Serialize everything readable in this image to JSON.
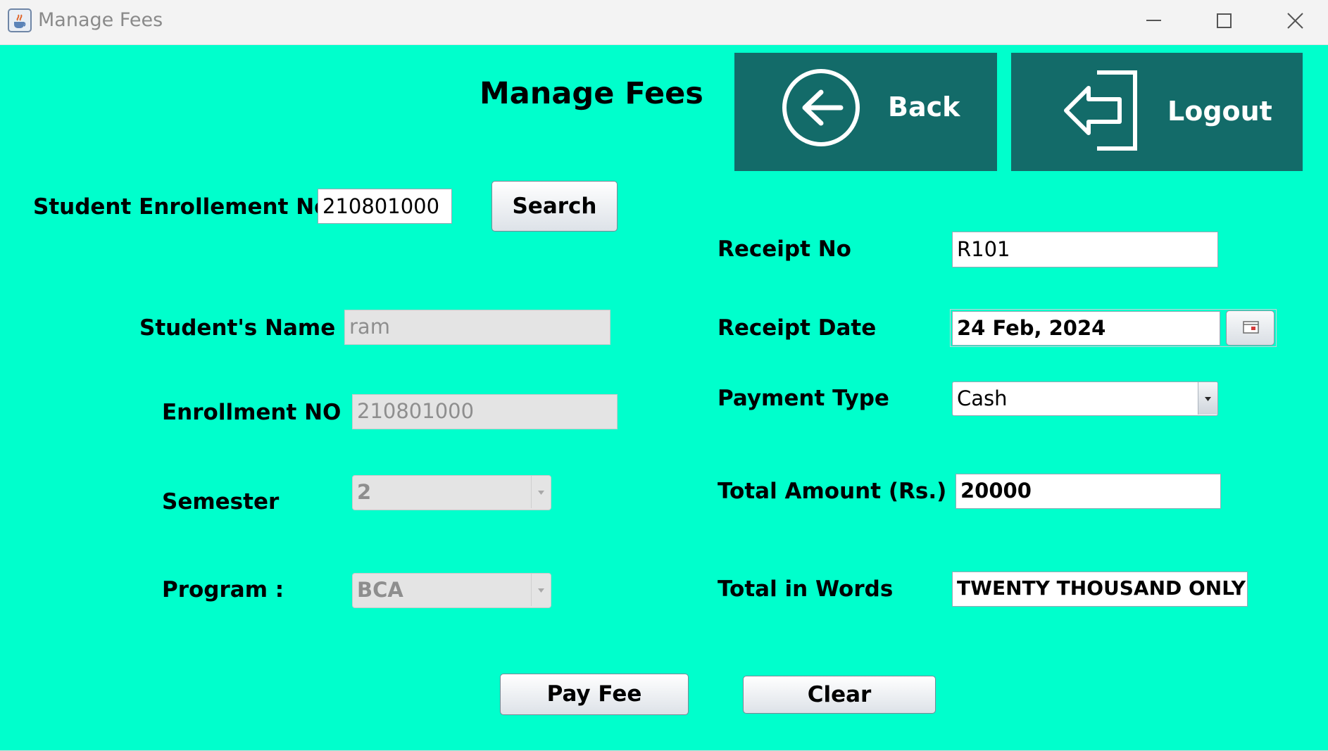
{
  "window": {
    "title": "Manage Fees",
    "app_icon": "java-cup-icon",
    "controls": [
      "minimize-icon",
      "maximize-icon",
      "close-icon"
    ]
  },
  "header": {
    "title": "Manage Fees",
    "back_label": "Back",
    "back_icon": "arrow-left-circle-icon",
    "logout_label": "Logout",
    "logout_icon": "logout-icon"
  },
  "search": {
    "label": "Student Enrollement No:",
    "value": "210801000",
    "button_label": "Search"
  },
  "student": {
    "name_label": "Student's Name",
    "name_value": "ram",
    "enrollment_label": "Enrollment NO",
    "enrollment_value": "210801000",
    "semester_label": "Semester",
    "semester_value": "2",
    "program_label": "Program :",
    "program_value": "BCA"
  },
  "receipt": {
    "no_label": "Receipt No",
    "no_value": "R101",
    "date_label": "Receipt Date",
    "date_value": "24 Feb, 2024",
    "date_button_icon": "calendar-icon",
    "payment_label": "Payment Type",
    "payment_value": "Cash",
    "amount_label": "Total Amount (Rs.)",
    "amount_value": "20000",
    "words_label": "Total in Words",
    "words_value": "TWENTY THOUSAND ONLY"
  },
  "actions": {
    "pay_label": "Pay Fee",
    "clear_label": "Clear"
  },
  "colors": {
    "background": "#00ffcc",
    "nav_button": "#136b69",
    "titlebar": "#f3f3f3"
  }
}
